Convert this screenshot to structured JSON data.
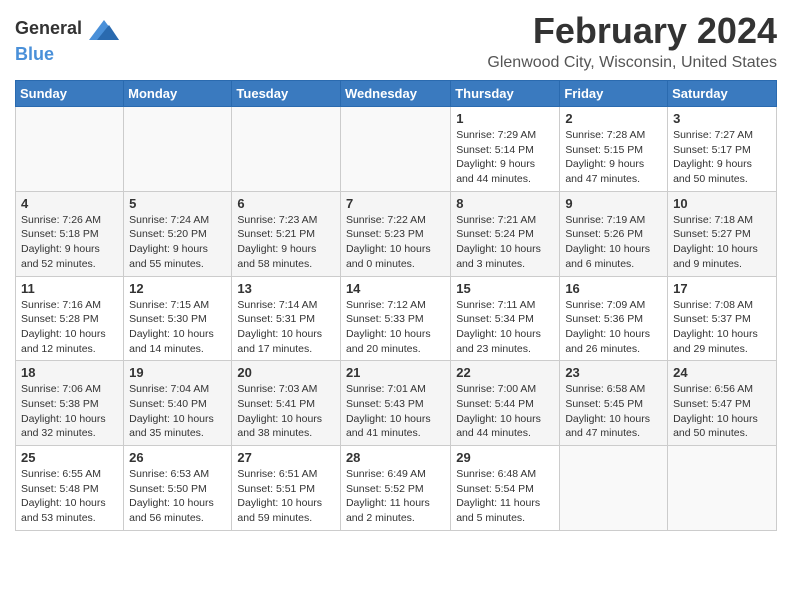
{
  "header": {
    "logo_general": "General",
    "logo_blue": "Blue",
    "month": "February 2024",
    "location": "Glenwood City, Wisconsin, United States"
  },
  "weekdays": [
    "Sunday",
    "Monday",
    "Tuesday",
    "Wednesday",
    "Thursday",
    "Friday",
    "Saturday"
  ],
  "weeks": [
    [
      {
        "day": "",
        "info": ""
      },
      {
        "day": "",
        "info": ""
      },
      {
        "day": "",
        "info": ""
      },
      {
        "day": "",
        "info": ""
      },
      {
        "day": "1",
        "info": "Sunrise: 7:29 AM\nSunset: 5:14 PM\nDaylight: 9 hours\nand 44 minutes."
      },
      {
        "day": "2",
        "info": "Sunrise: 7:28 AM\nSunset: 5:15 PM\nDaylight: 9 hours\nand 47 minutes."
      },
      {
        "day": "3",
        "info": "Sunrise: 7:27 AM\nSunset: 5:17 PM\nDaylight: 9 hours\nand 50 minutes."
      }
    ],
    [
      {
        "day": "4",
        "info": "Sunrise: 7:26 AM\nSunset: 5:18 PM\nDaylight: 9 hours\nand 52 minutes."
      },
      {
        "day": "5",
        "info": "Sunrise: 7:24 AM\nSunset: 5:20 PM\nDaylight: 9 hours\nand 55 minutes."
      },
      {
        "day": "6",
        "info": "Sunrise: 7:23 AM\nSunset: 5:21 PM\nDaylight: 9 hours\nand 58 minutes."
      },
      {
        "day": "7",
        "info": "Sunrise: 7:22 AM\nSunset: 5:23 PM\nDaylight: 10 hours\nand 0 minutes."
      },
      {
        "day": "8",
        "info": "Sunrise: 7:21 AM\nSunset: 5:24 PM\nDaylight: 10 hours\nand 3 minutes."
      },
      {
        "day": "9",
        "info": "Sunrise: 7:19 AM\nSunset: 5:26 PM\nDaylight: 10 hours\nand 6 minutes."
      },
      {
        "day": "10",
        "info": "Sunrise: 7:18 AM\nSunset: 5:27 PM\nDaylight: 10 hours\nand 9 minutes."
      }
    ],
    [
      {
        "day": "11",
        "info": "Sunrise: 7:16 AM\nSunset: 5:28 PM\nDaylight: 10 hours\nand 12 minutes."
      },
      {
        "day": "12",
        "info": "Sunrise: 7:15 AM\nSunset: 5:30 PM\nDaylight: 10 hours\nand 14 minutes."
      },
      {
        "day": "13",
        "info": "Sunrise: 7:14 AM\nSunset: 5:31 PM\nDaylight: 10 hours\nand 17 minutes."
      },
      {
        "day": "14",
        "info": "Sunrise: 7:12 AM\nSunset: 5:33 PM\nDaylight: 10 hours\nand 20 minutes."
      },
      {
        "day": "15",
        "info": "Sunrise: 7:11 AM\nSunset: 5:34 PM\nDaylight: 10 hours\nand 23 minutes."
      },
      {
        "day": "16",
        "info": "Sunrise: 7:09 AM\nSunset: 5:36 PM\nDaylight: 10 hours\nand 26 minutes."
      },
      {
        "day": "17",
        "info": "Sunrise: 7:08 AM\nSunset: 5:37 PM\nDaylight: 10 hours\nand 29 minutes."
      }
    ],
    [
      {
        "day": "18",
        "info": "Sunrise: 7:06 AM\nSunset: 5:38 PM\nDaylight: 10 hours\nand 32 minutes."
      },
      {
        "day": "19",
        "info": "Sunrise: 7:04 AM\nSunset: 5:40 PM\nDaylight: 10 hours\nand 35 minutes."
      },
      {
        "day": "20",
        "info": "Sunrise: 7:03 AM\nSunset: 5:41 PM\nDaylight: 10 hours\nand 38 minutes."
      },
      {
        "day": "21",
        "info": "Sunrise: 7:01 AM\nSunset: 5:43 PM\nDaylight: 10 hours\nand 41 minutes."
      },
      {
        "day": "22",
        "info": "Sunrise: 7:00 AM\nSunset: 5:44 PM\nDaylight: 10 hours\nand 44 minutes."
      },
      {
        "day": "23",
        "info": "Sunrise: 6:58 AM\nSunset: 5:45 PM\nDaylight: 10 hours\nand 47 minutes."
      },
      {
        "day": "24",
        "info": "Sunrise: 6:56 AM\nSunset: 5:47 PM\nDaylight: 10 hours\nand 50 minutes."
      }
    ],
    [
      {
        "day": "25",
        "info": "Sunrise: 6:55 AM\nSunset: 5:48 PM\nDaylight: 10 hours\nand 53 minutes."
      },
      {
        "day": "26",
        "info": "Sunrise: 6:53 AM\nSunset: 5:50 PM\nDaylight: 10 hours\nand 56 minutes."
      },
      {
        "day": "27",
        "info": "Sunrise: 6:51 AM\nSunset: 5:51 PM\nDaylight: 10 hours\nand 59 minutes."
      },
      {
        "day": "28",
        "info": "Sunrise: 6:49 AM\nSunset: 5:52 PM\nDaylight: 11 hours\nand 2 minutes."
      },
      {
        "day": "29",
        "info": "Sunrise: 6:48 AM\nSunset: 5:54 PM\nDaylight: 11 hours\nand 5 minutes."
      },
      {
        "day": "",
        "info": ""
      },
      {
        "day": "",
        "info": ""
      }
    ]
  ]
}
